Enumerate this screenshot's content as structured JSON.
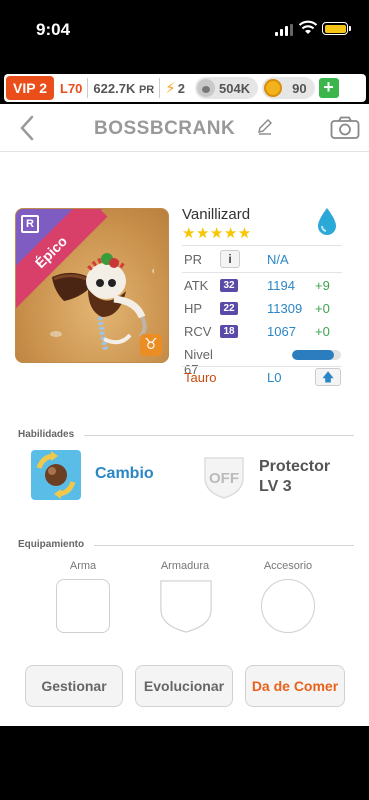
{
  "status_bar": {
    "time": "9:04"
  },
  "resources": {
    "vip": "VIP 2",
    "level": "L70",
    "power": "622.7K",
    "power_unit": "PR",
    "energy": "2",
    "paw_currency": "504K",
    "coins": "90"
  },
  "header": {
    "title": "BOSSBCRANK"
  },
  "pet": {
    "rarity": "Épico",
    "rarity_badge": "R",
    "name": "Vanillizard",
    "stars": "★★★★★",
    "element_icon": "water-drop-icon",
    "pr_label": "PR",
    "pr_value": "N/A",
    "stats": [
      {
        "label": "ATK",
        "badge": "32",
        "value": "1194",
        "inc": "+9"
      },
      {
        "label": "HP",
        "badge": "22",
        "value": "11309",
        "inc": "+0"
      },
      {
        "label": "RCV",
        "badge": "18",
        "value": "1067",
        "inc": "+0"
      }
    ],
    "level_label": "Nivel 67",
    "level_progress": 0.85,
    "zodiac": "Tauro",
    "zodiac_level": "L0"
  },
  "skills": {
    "section_title": "Habilidades",
    "active_name": "Cambio",
    "passive_badge": "OFF",
    "passive_name": "Protector",
    "passive_level": "LV 3"
  },
  "equipment": {
    "section_title": "Equipamiento",
    "slots": [
      "Arma",
      "Armadura",
      "Accesorio"
    ]
  },
  "actions": {
    "manage": "Gestionar",
    "evolve": "Evolucionar",
    "feed": "Da de Comer"
  },
  "colors": {
    "accent_blue": "#2b86c5",
    "vip_orange": "#e94e1b",
    "feed_orange": "#e9621b",
    "star_yellow": "#f7c600",
    "epic_pink": "#d8406a"
  }
}
